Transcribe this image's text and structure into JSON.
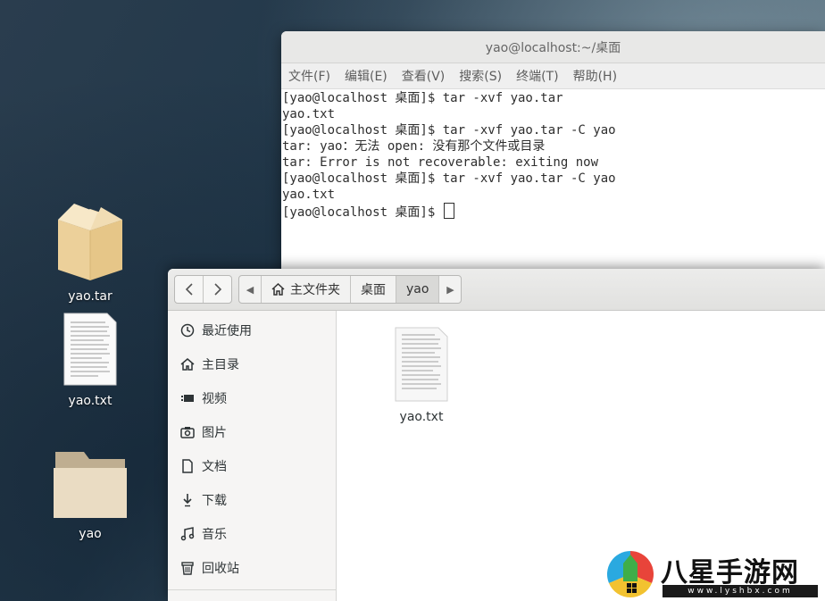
{
  "desktop": {
    "icons": [
      {
        "label": "yao.tar"
      },
      {
        "label": "yao.txt"
      },
      {
        "label": "yao"
      }
    ]
  },
  "terminal": {
    "title": "yao@localhost:~/桌面",
    "menu": [
      "文件(F)",
      "编辑(E)",
      "查看(V)",
      "搜索(S)",
      "终端(T)",
      "帮助(H)"
    ],
    "lines": [
      "[yao@localhost 桌面]$ tar -xvf yao.tar",
      "yao.txt",
      "[yao@localhost 桌面]$ tar -xvf yao.tar -C yao",
      "tar: yao：无法 open: 没有那个文件或目录",
      "tar: Error is not recoverable: exiting now",
      "[yao@localhost 桌面]$ tar -xvf yao.tar -C yao",
      "yao.txt"
    ],
    "prompt": "[yao@localhost 桌面]$ "
  },
  "files": {
    "path": [
      "主文件夹",
      "桌面",
      "yao"
    ],
    "sidebar": [
      {
        "label": "最近使用",
        "icon": "clock-icon"
      },
      {
        "label": "主目录",
        "icon": "home-icon"
      },
      {
        "label": "视频",
        "icon": "video-icon"
      },
      {
        "label": "图片",
        "icon": "camera-icon"
      },
      {
        "label": "文档",
        "icon": "document-icon"
      },
      {
        "label": "下载",
        "icon": "download-icon"
      },
      {
        "label": "音乐",
        "icon": "music-icon"
      },
      {
        "label": "回收站",
        "icon": "trash-icon"
      }
    ],
    "items": [
      {
        "label": "yao.txt"
      }
    ]
  },
  "watermark": {
    "text": "八星手游网",
    "url": "www.lyshbx.com"
  }
}
